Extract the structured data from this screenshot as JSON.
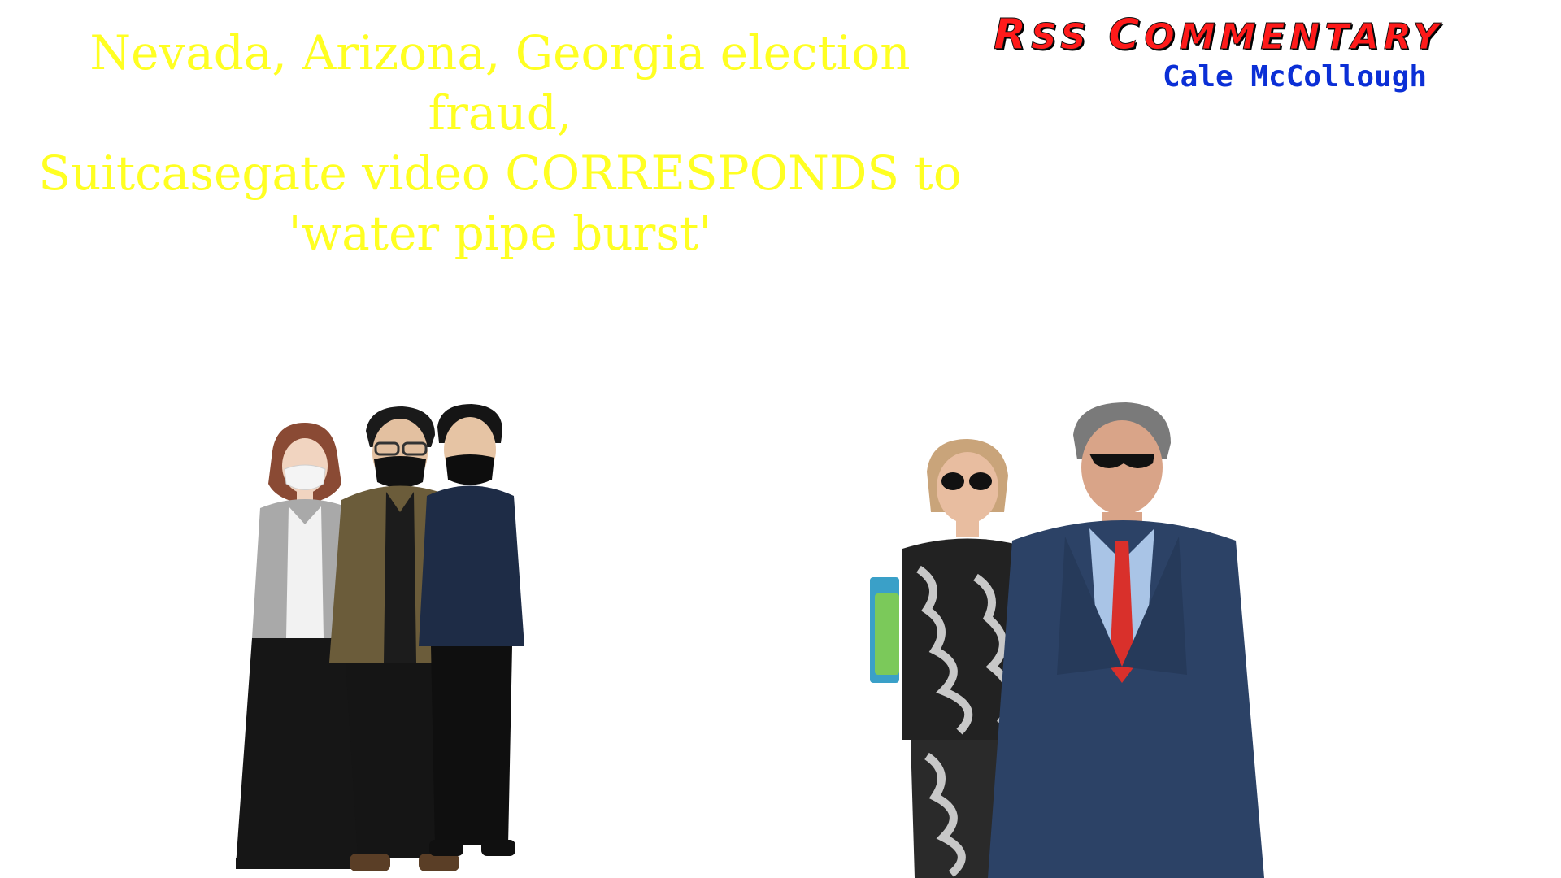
{
  "headline": {
    "line1": "Nevada, Arizona, Georgia election fraud,",
    "line2": "Suitcasegate video CORRESPONDS to",
    "line3": "'water pipe burst'"
  },
  "brand": {
    "title_r": "R",
    "title_rest1": "SS ",
    "title_c": "C",
    "title_rest2": "OMMENTARY",
    "author": "Cale McCollough",
    "title_color": "#ff1a1a",
    "author_color": "#0b2fd6"
  },
  "photos": {
    "left_group": "three-people-masked-icon",
    "right_group": "two-people-walking-icon"
  },
  "colors": {
    "headline": "#ffff22",
    "background": "#ffffff"
  }
}
